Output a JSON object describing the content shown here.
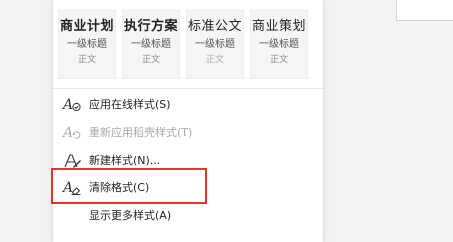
{
  "presets": [
    {
      "title": "商业计划",
      "heading": "一级标题",
      "body": "正文"
    },
    {
      "title": "执行方案",
      "heading": "一级标题",
      "body": "正文"
    },
    {
      "title": "标准公文",
      "heading": "一级标题",
      "body": "正文"
    },
    {
      "title": "商业策划",
      "heading": "一级标题",
      "body": "正文"
    }
  ],
  "menu": {
    "apply_online": {
      "label": "应用在线样式(S)",
      "icon": "online-style-icon"
    },
    "reapply_template": {
      "label": "重新应用稻壳样式(T)",
      "icon": "refresh-style-icon"
    },
    "new_style": {
      "label": "新建样式(N)...",
      "icon": "new-style-pen-icon"
    },
    "clear_format": {
      "label": "清除格式(C)",
      "icon": "clear-format-eraser-icon"
    },
    "more_styles": {
      "label": "显示更多样式(A)"
    }
  },
  "colors": {
    "highlight": "#d9382d",
    "disabled_text": "#a8a8a8"
  }
}
